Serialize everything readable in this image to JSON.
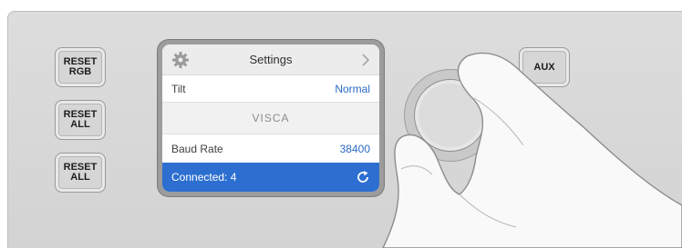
{
  "hardware": {
    "left_buttons": [
      "RESET\nRGB",
      "RESET\nALL",
      "RESET\nALL"
    ],
    "aux_label": "AUX"
  },
  "lcd": {
    "title": "Settings",
    "icons": {
      "settings": "gear-icon",
      "next": "chevron-right-icon",
      "refresh": "refresh-icon"
    },
    "tilt": {
      "label": "Tilt",
      "value": "Normal"
    },
    "section_label": "VISCA",
    "baud_rate": {
      "label": "Baud Rate",
      "value": "38400"
    },
    "connection": {
      "label": "Connected: 4"
    },
    "accent_color": "#2d6fd0"
  }
}
